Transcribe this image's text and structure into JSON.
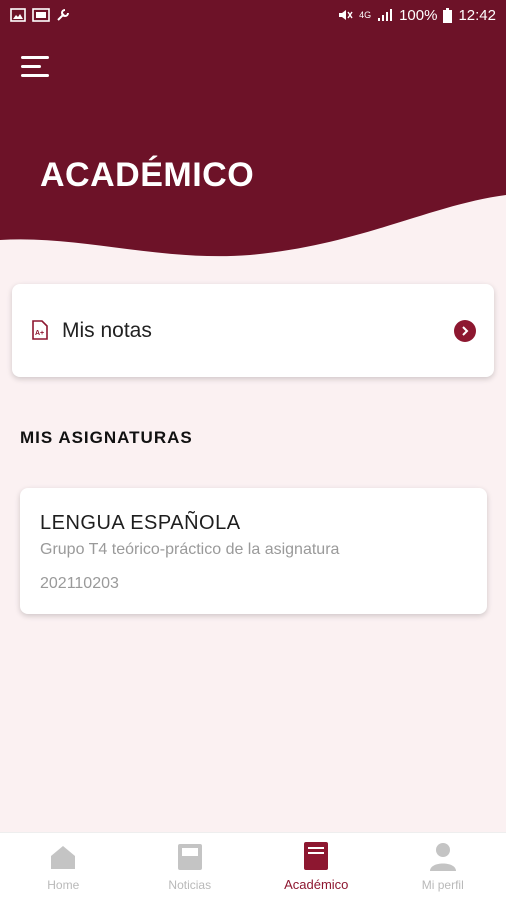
{
  "status_bar": {
    "battery_percent": "100%",
    "time": "12:42",
    "network_label": "4G"
  },
  "header": {
    "title": "ACADÉMICO"
  },
  "notas_card": {
    "label": "Mis notas"
  },
  "section": {
    "title": "MIS ASIGNATURAS"
  },
  "subjects": [
    {
      "name": "LENGUA ESPAÑOLA",
      "group": "Grupo T4 teórico-práctico de la asignatura",
      "code": "202110203"
    }
  ],
  "bottom_nav": {
    "items": [
      {
        "label": "Home",
        "icon": "home-icon",
        "active": false
      },
      {
        "label": "Noticias",
        "icon": "news-icon",
        "active": false
      },
      {
        "label": "Académico",
        "icon": "book-icon",
        "active": true
      },
      {
        "label": "Mi perfil",
        "icon": "person-icon",
        "active": false
      }
    ]
  },
  "colors": {
    "brand": "#6d1228",
    "accent": "#8d1730",
    "background": "#fbf1f2",
    "inactive": "#b9b9b9"
  }
}
